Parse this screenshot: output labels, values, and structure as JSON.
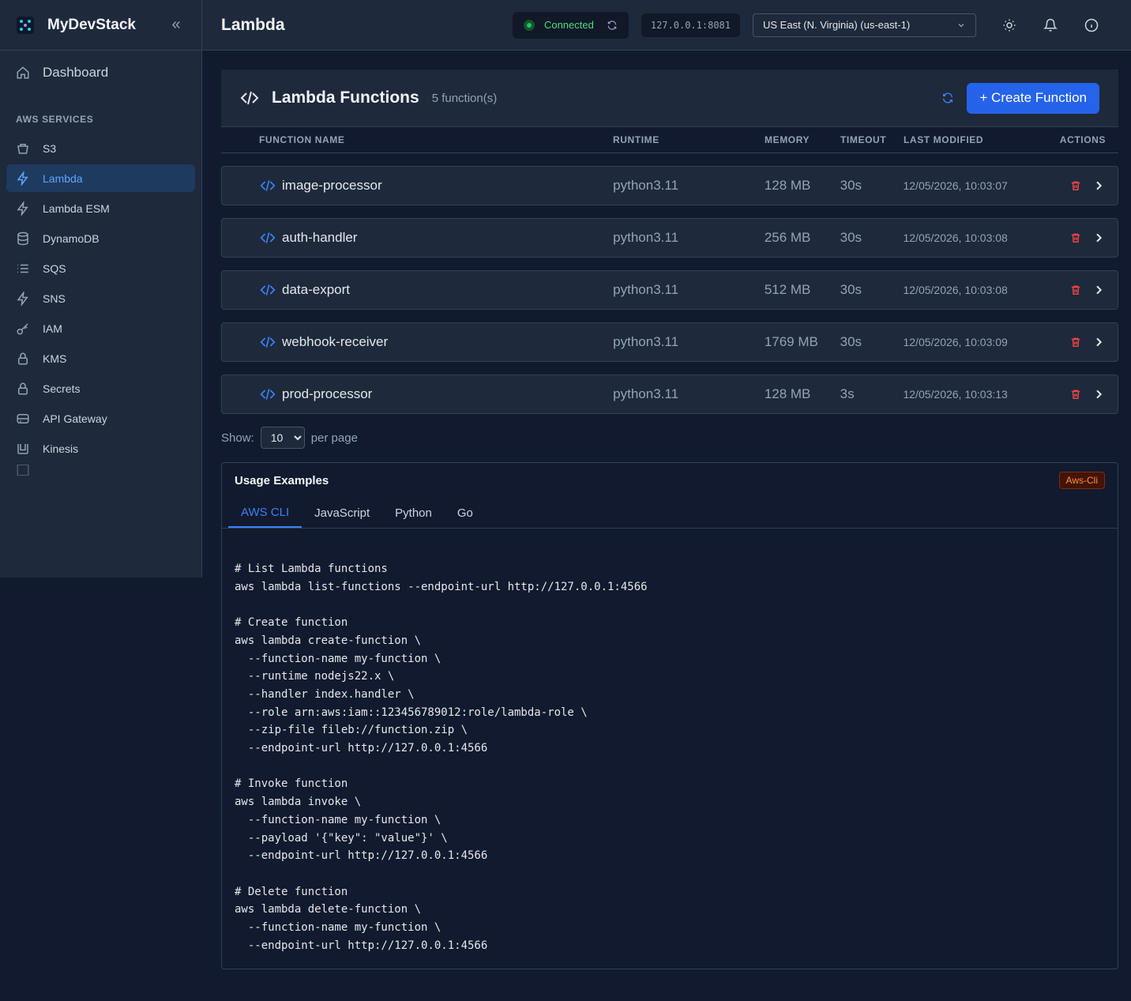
{
  "app": {
    "name": "MyDevStack",
    "page_title": "Lambda"
  },
  "sidebar": {
    "dashboard_label": "Dashboard",
    "section_label": "AWS SERVICES",
    "items": [
      {
        "label": "S3",
        "icon": "bucket-icon"
      },
      {
        "label": "Lambda",
        "icon": "bolt-icon",
        "active": true
      },
      {
        "label": "Lambda ESM",
        "icon": "bolt-icon"
      },
      {
        "label": "DynamoDB",
        "icon": "database-icon"
      },
      {
        "label": "SQS",
        "icon": "list-icon"
      },
      {
        "label": "SNS",
        "icon": "bolt-icon"
      },
      {
        "label": "IAM",
        "icon": "key-icon"
      },
      {
        "label": "KMS",
        "icon": "lock-icon"
      },
      {
        "label": "Secrets",
        "icon": "lock-icon"
      },
      {
        "label": "API Gateway",
        "icon": "server-icon"
      },
      {
        "label": "Kinesis",
        "icon": "stream-icon"
      }
    ]
  },
  "topbar": {
    "status_label": "Connected",
    "endpoint": "127.0.0.1:8081",
    "region": "US East (N. Virginia) (us-east-1)"
  },
  "panel": {
    "title": "Lambda Functions",
    "count": "5 function(s)",
    "create_label": "+ Create Function",
    "columns": [
      "FUNCTION NAME",
      "RUNTIME",
      "MEMORY",
      "TIMEOUT",
      "LAST MODIFIED",
      "ACTIONS"
    ],
    "functions": [
      {
        "name": "image-processor",
        "runtime": "python3.11",
        "memory": "128 MB",
        "timeout": "30s",
        "modified": "12/05/2026, 10:03:07"
      },
      {
        "name": "auth-handler",
        "runtime": "python3.11",
        "memory": "256 MB",
        "timeout": "30s",
        "modified": "12/05/2026, 10:03:08"
      },
      {
        "name": "data-export",
        "runtime": "python3.11",
        "memory": "512 MB",
        "timeout": "30s",
        "modified": "12/05/2026, 10:03:08"
      },
      {
        "name": "webhook-receiver",
        "runtime": "python3.11",
        "memory": "1769 MB",
        "timeout": "30s",
        "modified": "12/05/2026, 10:03:09"
      },
      {
        "name": "prod-processor",
        "runtime": "python3.11",
        "memory": "128 MB",
        "timeout": "3s",
        "modified": "12/05/2026, 10:03:13"
      }
    ]
  },
  "pager": {
    "show_label": "Show:",
    "per_page_value": "10",
    "per_page_label": "per page"
  },
  "usage": {
    "title": "Usage Examples",
    "badge": "Aws-Cli",
    "tabs": [
      "AWS CLI",
      "JavaScript",
      "Python",
      "Go"
    ],
    "active_tab": "AWS CLI",
    "code": "# List Lambda functions\naws lambda list-functions --endpoint-url http://127.0.0.1:4566\n\n# Create function\naws lambda create-function \\\n  --function-name my-function \\\n  --runtime nodejs22.x \\\n  --handler index.handler \\\n  --role arn:aws:iam::123456789012:role/lambda-role \\\n  --zip-file fileb://function.zip \\\n  --endpoint-url http://127.0.0.1:4566\n\n# Invoke function\naws lambda invoke \\\n  --function-name my-function \\\n  --payload '{\"key\": \"value\"}' \\\n  --endpoint-url http://127.0.0.1:4566\n\n# Delete function\naws lambda delete-function \\\n  --function-name my-function \\\n  --endpoint-url http://127.0.0.1:4566"
  },
  "colors": {
    "accent": "#2563eb",
    "active_nav_bg": "#1f3a5f",
    "success": "#22c55e",
    "danger": "#ef4444",
    "badge": "#fb923c"
  }
}
